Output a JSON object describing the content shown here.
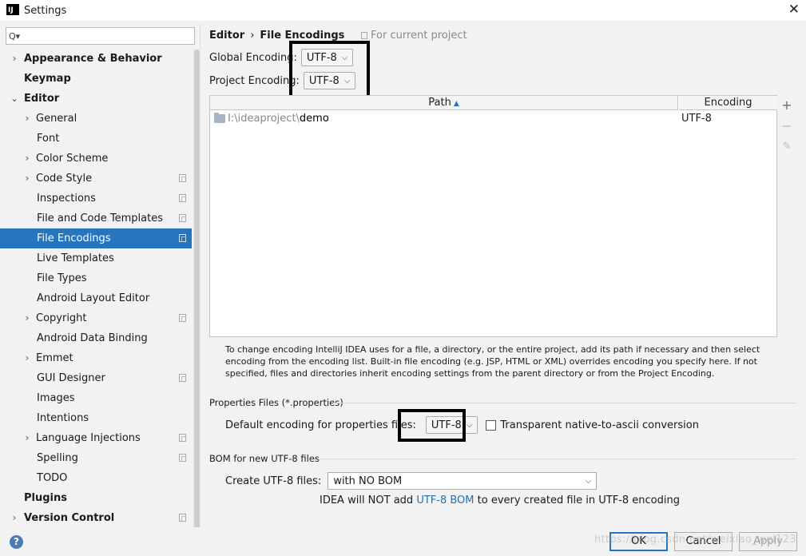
{
  "window": {
    "title": "Settings",
    "app_icon": "IJ",
    "close_glyph": "✕"
  },
  "search": {
    "placeholder": "",
    "icon": "Q▾"
  },
  "tree": [
    {
      "label": "Appearance & Behavior",
      "bold": true,
      "arrow": "›"
    },
    {
      "label": "Keymap",
      "bold": true
    },
    {
      "label": "Editor",
      "bold": true,
      "arrow": "⌄"
    },
    {
      "label": "General",
      "arrow": "›"
    },
    {
      "label": "Font"
    },
    {
      "label": "Color Scheme",
      "arrow": "›"
    },
    {
      "label": "Code Style",
      "arrow": "›",
      "cfg": true
    },
    {
      "label": "Inspections",
      "cfg": true
    },
    {
      "label": "File and Code Templates",
      "cfg": true
    },
    {
      "label": "File Encodings",
      "cfg": true,
      "selected": true
    },
    {
      "label": "Live Templates"
    },
    {
      "label": "File Types"
    },
    {
      "label": "Android Layout Editor"
    },
    {
      "label": "Copyright",
      "arrow": "›",
      "cfg": true
    },
    {
      "label": "Android Data Binding"
    },
    {
      "label": "Emmet",
      "arrow": "›"
    },
    {
      "label": "GUI Designer",
      "cfg": true
    },
    {
      "label": "Images"
    },
    {
      "label": "Intentions"
    },
    {
      "label": "Language Injections",
      "arrow": "›",
      "cfg": true
    },
    {
      "label": "Spelling",
      "cfg": true
    },
    {
      "label": "TODO"
    },
    {
      "label": "Plugins",
      "bold": true
    },
    {
      "label": "Version Control",
      "bold": true,
      "arrow": "›",
      "cfg": true
    }
  ],
  "breadcrumb": {
    "parent": "Editor",
    "sep": "›",
    "current": "File Encodings",
    "scope": "For current project"
  },
  "global_encoding": {
    "label": "Global Encoding:",
    "value": "UTF-8"
  },
  "project_encoding": {
    "label": "Project Encoding:",
    "value": "UTF-8"
  },
  "table": {
    "col_path": "Path",
    "col_encoding": "Encoding",
    "rows": [
      {
        "path_prefix": "I:\\ideaproject\\",
        "path_name": "demo",
        "encoding": "UTF-8"
      }
    ]
  },
  "tools": {
    "add": "+",
    "remove": "−",
    "edit": "✎"
  },
  "help_text": "To change encoding IntelliJ IDEA uses for a file, a directory, or the entire project, add its path if necessary and then select encoding from the encoding list. Built-in file encoding (e.g. JSP, HTML or XML) overrides encoding you specify here. If not specified, files and directories inherit encoding settings from the parent directory or from the Project Encoding.",
  "properties": {
    "section": "Properties Files (*.properties)",
    "label": "Default encoding for properties files:",
    "value": "UTF-8",
    "checkbox_label": "Transparent native-to-ascii conversion",
    "checked": false
  },
  "bom": {
    "section": "BOM for new UTF-8 files",
    "label": "Create UTF-8 files:",
    "value": "with NO BOM",
    "note_pre": "IDEA will NOT add ",
    "note_link": "UTF-8 BOM",
    "note_post": " to every created file in UTF-8 encoding"
  },
  "footer": {
    "help": "?",
    "ok": "OK",
    "cancel": "Cancel",
    "apply": "Apply"
  },
  "watermark": "https://blog.csdn.net/weixiao_wei123"
}
